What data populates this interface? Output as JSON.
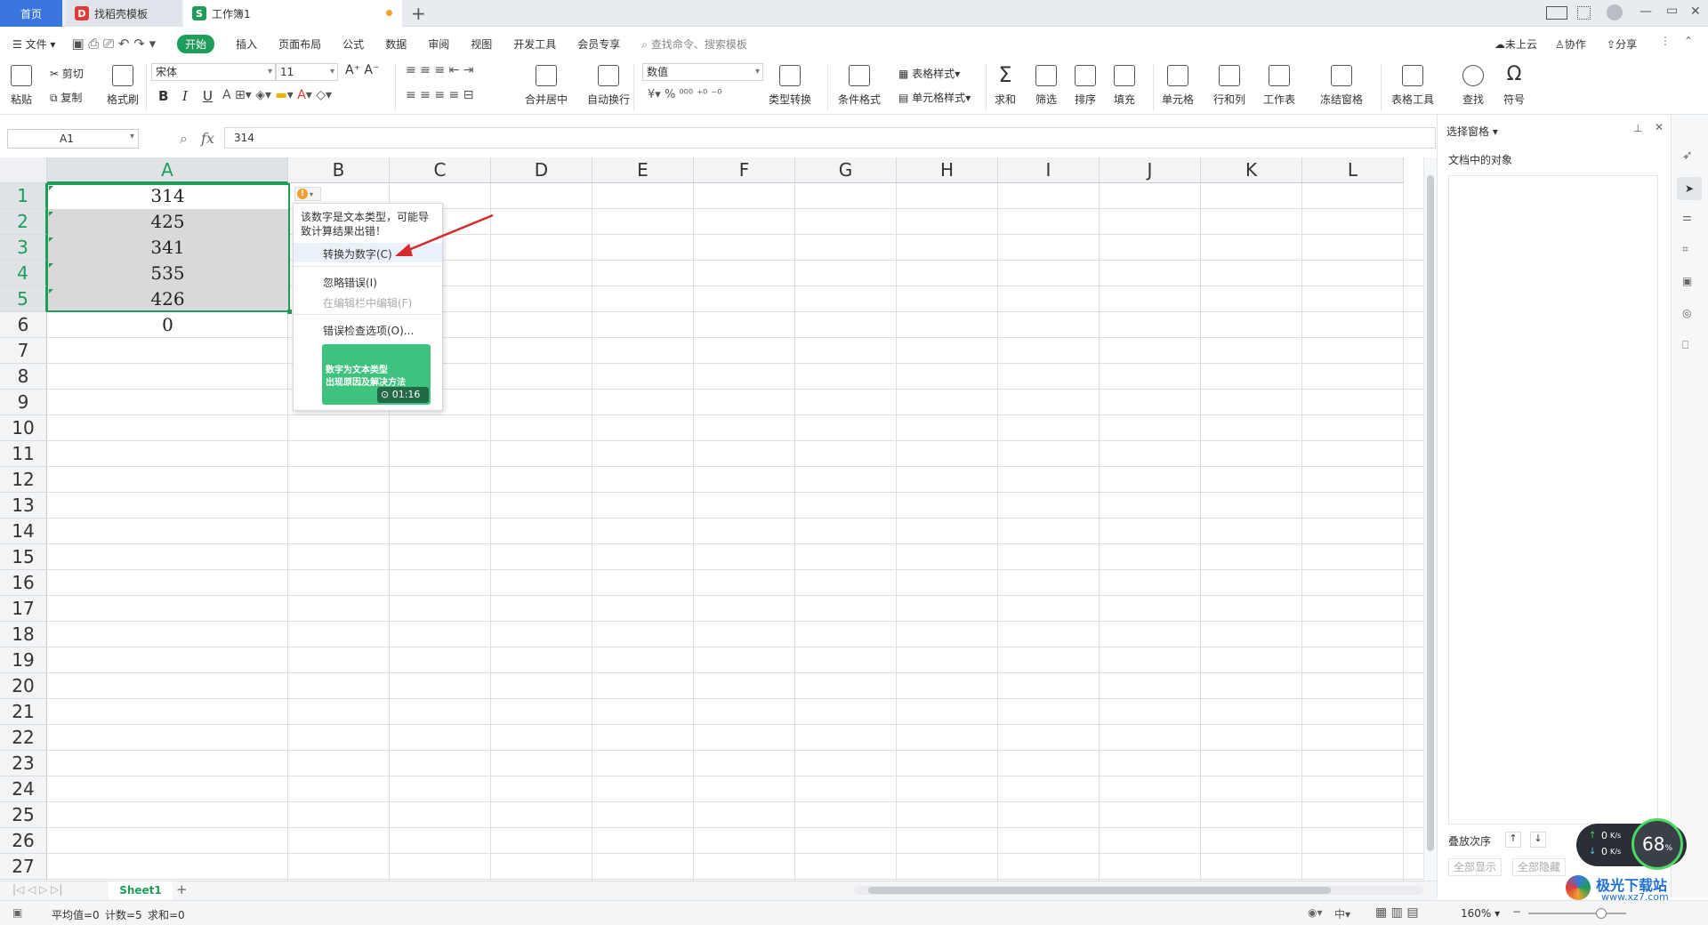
{
  "tabs": {
    "home": "首页",
    "template": "找稻壳模板",
    "workbook": "工作簿1",
    "add": "+"
  },
  "window_controls": {
    "minimize": "—",
    "restore": "▭",
    "close": "✕"
  },
  "menubar": {
    "file": "文件",
    "items": [
      "开始",
      "插入",
      "页面布局",
      "公式",
      "数据",
      "审阅",
      "视图",
      "开发工具",
      "会员专享"
    ],
    "search_placeholder": "查找命令、搜索模板",
    "right": [
      "未上云",
      "协作",
      "分享"
    ]
  },
  "ribbon": {
    "paste": "粘贴",
    "cut": "剪切",
    "copy": "复制",
    "format_painter": "格式刷",
    "font_name": "宋体",
    "font_size": "11",
    "bold": "B",
    "italic": "I",
    "underline": "U",
    "merge": "合并居中",
    "wrap": "自动换行",
    "number_format": "数值",
    "percent": "%",
    "type_convert": "类型转换",
    "cond_format": "条件格式",
    "table_style": "表格样式",
    "cell_style": "单元格样式",
    "sum": "求和",
    "filter": "筛选",
    "sort": "排序",
    "fill": "填充",
    "cell": "单元格",
    "row_col": "行和列",
    "worksheet": "工作表",
    "freeze": "冻结窗格",
    "table_tools": "表格工具",
    "find": "查找",
    "symbol": "符号"
  },
  "formula": {
    "name_box": "A1",
    "fx": "fx",
    "value": "314"
  },
  "columns": [
    "A",
    "B",
    "C",
    "D",
    "E",
    "F",
    "G",
    "H",
    "I",
    "J",
    "K",
    "L"
  ],
  "rows": [
    "1",
    "2",
    "3",
    "4",
    "5",
    "6",
    "7",
    "8",
    "9",
    "10",
    "11",
    "12",
    "13",
    "14",
    "15",
    "16",
    "17",
    "18",
    "19",
    "20",
    "21",
    "22",
    "23",
    "24",
    "25",
    "26",
    "27"
  ],
  "cells": {
    "A1": "314",
    "A2": "425",
    "A3": "341",
    "A4": "535",
    "A5": "426",
    "A6": "0"
  },
  "popup": {
    "warning": "该数字是文本类型，可能导致计算结果出错！",
    "warning_line1": "该数字是文本类型，可能导",
    "warning_line2": "致计算结果出错！",
    "convert": "转换为数字(C)",
    "ignore": "忽略错误(I)",
    "edit_in_bar": "在编辑栏中编辑(F)",
    "options": "错误检查选项(O)...",
    "video_line1": "数字为文本类型",
    "video_line2": "出现原因及解决方法",
    "video_time": "01:16"
  },
  "pane": {
    "title": "选择窗格",
    "objects": "文档中的对象",
    "order": "叠放次序",
    "show_all": "全部显示",
    "hide_all": "全部隐藏"
  },
  "net": {
    "up": "0",
    "down": "0",
    "up_unit": "K/s",
    "down_unit": "K/s",
    "percent": "68",
    "percent_unit": "%"
  },
  "sheetbar": {
    "sheet": "Sheet1",
    "add": "+"
  },
  "status": {
    "avg": "平均值=0",
    "count": "计数=5",
    "sum": "求和=0",
    "zoom": "160%",
    "ime": "中"
  },
  "watermark": {
    "site": "极光下载站",
    "url": "www.xz7.com"
  },
  "colors": {
    "green": "#1e9c5a",
    "blue": "#3b76e0",
    "arrow": "#d42a2a",
    "warn": "#f0a030"
  }
}
